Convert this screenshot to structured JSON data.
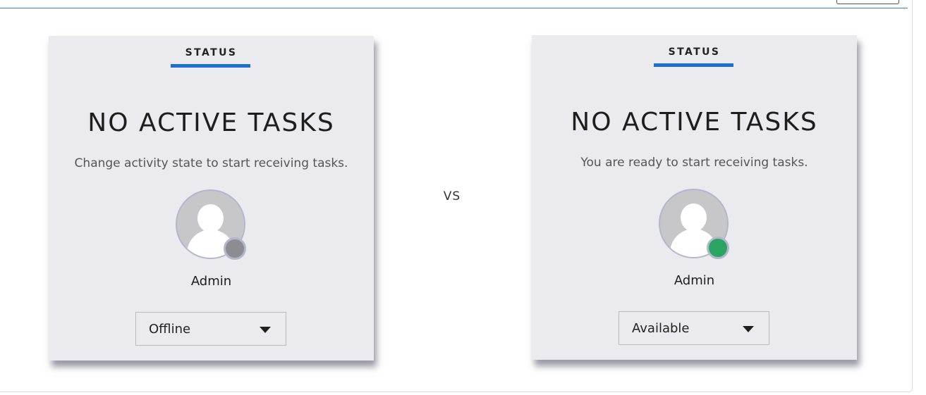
{
  "comparison_label": "VS",
  "cards": {
    "left": {
      "status_label": "STATUS",
      "headline": "NO ACTIVE TASKS",
      "subtext": "Change activity state to start receiving tasks.",
      "user_name": "Admin",
      "presence": "offline",
      "presence_color": "#8c8c92",
      "select_value": "Offline"
    },
    "right": {
      "status_label": "STATUS",
      "headline": "NO ACTIVE TASKS",
      "subtext": "You are ready to start receiving tasks.",
      "user_name": "Admin",
      "presence": "available",
      "presence_color": "#2aa463",
      "select_value": "Available"
    }
  },
  "colors": {
    "accent": "#1a6fd1",
    "card_background": "#ebebef",
    "top_rule": "#3b7fd4"
  }
}
